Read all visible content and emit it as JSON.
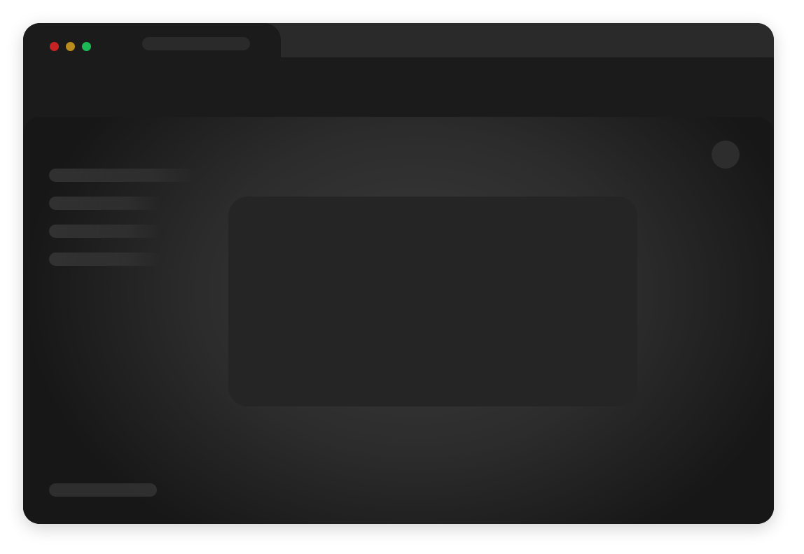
{
  "window": {
    "traffic_lights": [
      {
        "name": "close",
        "color": "#c62424"
      },
      {
        "name": "minimize",
        "color": "#b98c1d"
      },
      {
        "name": "maximize",
        "color": "#1cb855"
      }
    ]
  },
  "theme": {
    "background": "#1b1b1b",
    "tabstrip": "#2a2a2a",
    "card": "#252525"
  },
  "sidebar": {
    "placeholder_items": 4,
    "footer_placeholder": 1
  }
}
